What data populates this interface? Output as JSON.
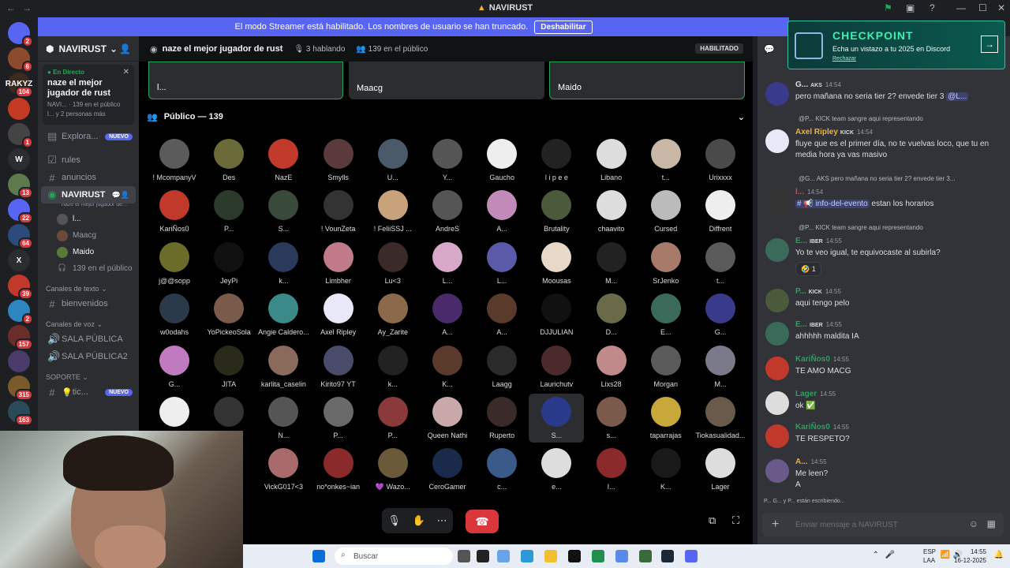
{
  "titlebar": {
    "title": "NAVIRUST"
  },
  "banner": {
    "text": "El modo Streamer está habilitado. Los nombres de usuario se han truncado.",
    "button": "Deshabilitar"
  },
  "rail": {
    "guilds": [
      {
        "label": "",
        "color": "#5865f2",
        "badge": "2"
      },
      {
        "label": "",
        "color": "#8b4a2c",
        "badge": "6"
      },
      {
        "label": "RAKYZ",
        "color": "#3b2a1e",
        "badge": "104"
      },
      {
        "label": "",
        "color": "#c23b22",
        "badge": ""
      },
      {
        "label": "",
        "color": "#444",
        "badge": "1"
      },
      {
        "label": "W",
        "color": "#2b2d31",
        "badge": ""
      },
      {
        "label": "",
        "color": "#5d7a4e",
        "badge": "13"
      },
      {
        "label": "",
        "color": "#5865f2",
        "badge": "22"
      },
      {
        "label": "",
        "color": "#2c4a7a",
        "badge": "64"
      },
      {
        "label": "X",
        "color": "#2b2d31",
        "badge": ""
      },
      {
        "label": "",
        "color": "#c0392b",
        "badge": "39"
      },
      {
        "label": "",
        "color": "#2e86c1",
        "badge": "2"
      },
      {
        "label": "",
        "color": "#6b2c2c",
        "badge": "157"
      },
      {
        "label": "",
        "color": "#4a3b6b",
        "badge": ""
      },
      {
        "label": "",
        "color": "#7a5a2a",
        "badge": "315"
      },
      {
        "label": "",
        "color": "#2a4a5a",
        "badge": "163"
      }
    ]
  },
  "sidebar": {
    "server_name": "NAVIRUST",
    "live": {
      "status": "En Directo",
      "title": "naze el mejor jugador de rust",
      "meta": "NAVI... · 139 en el público",
      "viewers": "l... y 2 personas más"
    },
    "explore": "Explora...",
    "explore_badge": "NUEVO",
    "channels": [
      {
        "icon": "☑",
        "label": "rules"
      },
      {
        "icon": "#",
        "label": "anuncios"
      }
    ],
    "voice_active": {
      "name": "NAVIRUST",
      "subtitle": "naze el mejor jugador de..."
    },
    "voice_users": [
      "l...",
      "Maacg",
      "Maido"
    ],
    "voice_audience": "139 en el público",
    "text_category": "Canales de texto",
    "text_channels": [
      "bienvenidos"
    ],
    "voice_category": "Canales de voz",
    "voice_channels": [
      "SALA PÚBLICA",
      "SALA PÚBLICA2"
    ],
    "support_category": "SOPORTE",
    "support_channel": "tic...",
    "support_badge": "NUEVO"
  },
  "call": {
    "title": "naze el mejor jugador de rust",
    "speaking": "3 hablando",
    "audience": "139 en el público",
    "enabled_badge": "HABILITADO",
    "tiles": [
      "l...",
      "Maacg",
      "Maido"
    ],
    "audience_header": "Público — 139",
    "audience_members": [
      {
        "name": "! McompanyV",
        "color": "#5b5b5b"
      },
      {
        "name": "Des",
        "color": "#6b6b3a"
      },
      {
        "name": "NazE",
        "color": "#c0392b"
      },
      {
        "name": "Smylls",
        "color": "#5a3a3a"
      },
      {
        "name": "U...",
        "color": "#4a5a6a"
      },
      {
        "name": "Y...",
        "color": "#555"
      },
      {
        "name": "Gaucho",
        "color": "#eee"
      },
      {
        "name": "l i p e e",
        "color": "#222"
      },
      {
        "name": "Libano",
        "color": "#ddd"
      },
      {
        "name": "t...",
        "color": "#c9b8a8"
      },
      {
        "name": "Urixxxx",
        "color": "#4a4a4a"
      },
      {
        "name": "KariÑos0",
        "color": "#c0392b"
      },
      {
        "name": "P...",
        "color": "#2b3a2b"
      },
      {
        "name": "S...",
        "color": "#3a4a3a"
      },
      {
        "name": "! VounZeta",
        "color": "#333"
      },
      {
        "name": "! FeliiSSJ ...",
        "color": "#c7a27a"
      },
      {
        "name": "AndreS",
        "color": "#555"
      },
      {
        "name": "A...",
        "color": "#c28ab8"
      },
      {
        "name": "Brutality",
        "color": "#4a5a3a"
      },
      {
        "name": "chaavito",
        "color": "#ddd"
      },
      {
        "name": "Cursed",
        "color": "#bbb"
      },
      {
        "name": "Diffrent",
        "color": "#eee"
      },
      {
        "name": "j@@sopp",
        "color": "#6b6b2a"
      },
      {
        "name": "JeyPi",
        "color": "#111"
      },
      {
        "name": "k...",
        "color": "#2a3a5a"
      },
      {
        "name": "Limbher",
        "color": "#c07a8a"
      },
      {
        "name": "Lu<3",
        "color": "#3a2a2a"
      },
      {
        "name": "L...",
        "color": "#d8a8c8"
      },
      {
        "name": "L...",
        "color": "#5a5aa8"
      },
      {
        "name": "Moousas",
        "color": "#e8d8c8"
      },
      {
        "name": "M...",
        "color": "#222"
      },
      {
        "name": "SrJenko",
        "color": "#a87a6a"
      },
      {
        "name": "t...",
        "color": "#5a5a5a"
      },
      {
        "name": "w0odahs",
        "color": "#2a3a4a"
      },
      {
        "name": "YoPickeoSola",
        "color": "#7a5a4a"
      },
      {
        "name": "Angie Caldero...",
        "color": "#3a8a8a"
      },
      {
        "name": "Axel Ripley",
        "color": "#e8e8f8"
      },
      {
        "name": "Ay_Zarite",
        "color": "#8a6a4a"
      },
      {
        "name": "A...",
        "color": "#4a2a6a"
      },
      {
        "name": "A...",
        "color": "#5a3a2a"
      },
      {
        "name": "DJJULIAN",
        "color": "#111"
      },
      {
        "name": "D...",
        "color": "#6a6a4a"
      },
      {
        "name": "E...",
        "color": "#3a6a5a"
      },
      {
        "name": "G...",
        "color": "#3a3a8a"
      },
      {
        "name": "G...",
        "color": "#c07ac0"
      },
      {
        "name": "JITA",
        "color": "#2a2a1a"
      },
      {
        "name": "karlita_caselin",
        "color": "#8a6a5a"
      },
      {
        "name": "Kirito97 YT",
        "color": "#4a4a6a"
      },
      {
        "name": "k...",
        "color": "#222"
      },
      {
        "name": "K...",
        "color": "#5a3a2a"
      },
      {
        "name": "Laagg",
        "color": "#2a2a2a"
      },
      {
        "name": "Laurichutv",
        "color": "#4a2a2a"
      },
      {
        "name": "Lixs28",
        "color": "#c08a8a"
      },
      {
        "name": "Morgan",
        "color": "#5a5a5a"
      },
      {
        "name": "M...",
        "color": "#7a7a8a"
      },
      {
        "name": "",
        "color": "#eee"
      },
      {
        "name": "",
        "color": "#333"
      },
      {
        "name": "N...",
        "color": "#555"
      },
      {
        "name": "P...",
        "color": "#6a6a6a"
      },
      {
        "name": "P...",
        "color": "#8a3a3a"
      },
      {
        "name": "Queen Nathi",
        "color": "#c8a8a8"
      },
      {
        "name": "Ruperto",
        "color": "#3a2a2a"
      },
      {
        "name": "S...",
        "color": "#2a3a8a"
      },
      {
        "name": "s...",
        "color": "#7a5a4a"
      },
      {
        "name": "taparrajas",
        "color": "#c8a83a"
      },
      {
        "name": "Tiokasualidad...",
        "color": "#6a5a4a"
      },
      {
        "name": "",
        "color": "#000"
      },
      {
        "name": "",
        "color": "#000"
      },
      {
        "name": "VickG017<3",
        "color": "#a86a6a"
      },
      {
        "name": "no*onkes~ian",
        "color": "#8a2a2a"
      },
      {
        "name": "💜 Wazo...",
        "color": "#6a5a3a"
      },
      {
        "name": "CeroGamer",
        "color": "#1a2a4a"
      },
      {
        "name": "c...",
        "color": "#3a5a8a"
      },
      {
        "name": "e...",
        "color": "#ddd"
      },
      {
        "name": "I...",
        "color": "#8a2a2a"
      },
      {
        "name": "K...",
        "color": "#1a1a1a"
      },
      {
        "name": "Lager",
        "color": "#ddd"
      }
    ]
  },
  "promo": {
    "title": "CHECKPOINT",
    "subtitle": "Echa un vistazo a tu 2025 en Discord",
    "dismiss": "Rechazar"
  },
  "chat": {
    "messages": [
      {
        "name": "G...",
        "tag": "AKS",
        "time": "14:54",
        "color": "#dbdee1",
        "avatar": "#3a3a8a",
        "text": "pero mañana no seria tier 2? envede tier 3",
        "mention": "@L..."
      },
      {
        "reply": "@P... KICK team sangre aqui representando",
        "name": "Axel Ripley",
        "tag": "KICK",
        "time": "14:54",
        "color": "#f0b232",
        "avatar": "#e8e8f8",
        "text": "fluye que es el primer día, no te vuelvas loco, que tu en media hora ya vas masivo"
      },
      {
        "reply": "@G... AKS pero mañana no seria tier 2? envede tier 3...",
        "name": "l...",
        "tag": "",
        "time": "14:54",
        "color": "#f23f43",
        "avatar": "#333",
        "text": "estan los horarios",
        "mention": "# 📢 info-del-evento"
      },
      {
        "reply": "@P... KICK team sangre aqui representando",
        "name": "E...",
        "tag": "IBER",
        "time": "14:55",
        "color": "#23a55a",
        "avatar": "#3a6a5a",
        "text": "Yo te veo igual, te equivocaste al subirla?",
        "reaction": "🤣 1"
      },
      {
        "name": "P...",
        "tag": "KICK",
        "time": "14:55",
        "color": "#23a55a",
        "avatar": "#4a5a3a",
        "text": "aqui tengo pelo"
      },
      {
        "name": "E...",
        "tag": "IBER",
        "time": "14:55",
        "color": "#23a55a",
        "avatar": "#3a6a5a",
        "text": "ahhhhh maldita IA"
      },
      {
        "name": "KariÑos0",
        "tag": "",
        "time": "14:55",
        "color": "#23a55a",
        "avatar": "#c0392b",
        "text": "TE AMO MACG"
      },
      {
        "name": "Lager",
        "tag": "",
        "time": "14:55",
        "color": "#23a55a",
        "avatar": "#ddd",
        "text": "ok ✅"
      },
      {
        "name": "KariÑos0",
        "tag": "",
        "time": "14:55",
        "color": "#23a55a",
        "avatar": "#c0392b",
        "text": "TE RESPETO?"
      },
      {
        "name": "A...",
        "tag": "",
        "time": "14:55",
        "color": "#f0b232",
        "avatar": "#6a5a8a",
        "text": "Me leen?",
        "text2": "A"
      }
    ],
    "typing": "P... G... y P... están escribiendo...",
    "input_placeholder": "Enviar mensaje a NAVIRUST"
  },
  "taskbar": {
    "search": "Buscar",
    "lang1": "ESP",
    "lang2": "LAA",
    "time": "14:55",
    "date": "16-12-2025"
  }
}
